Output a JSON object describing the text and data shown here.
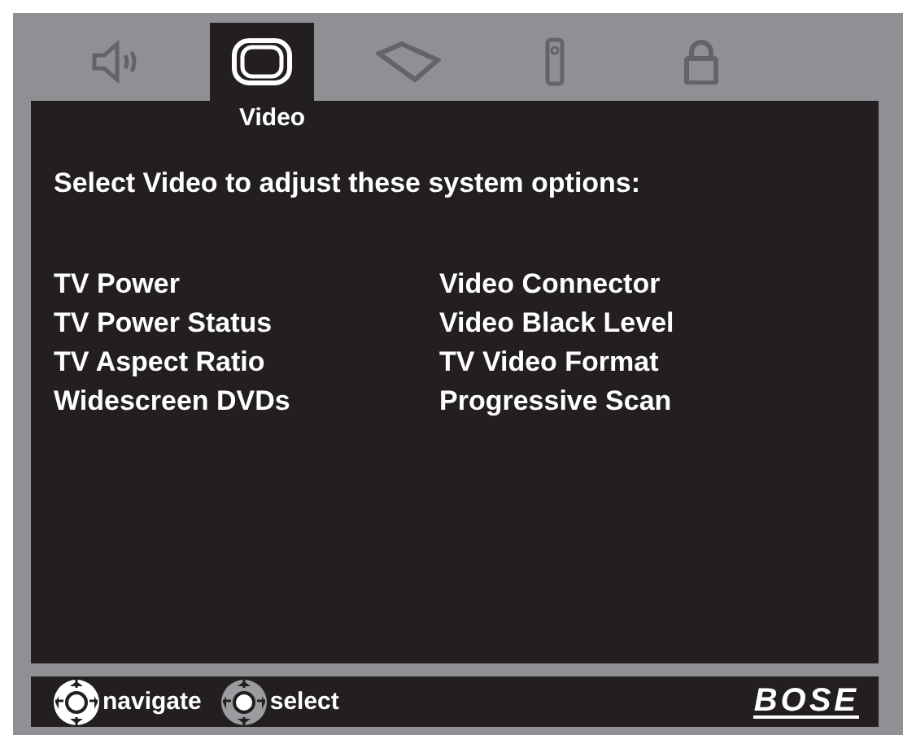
{
  "tabs": [
    {
      "kind": "speaker",
      "selected": false
    },
    {
      "kind": "video",
      "selected": true,
      "label": "Video"
    },
    {
      "kind": "player",
      "selected": false
    },
    {
      "kind": "remote",
      "selected": false
    },
    {
      "kind": "lock",
      "selected": false
    }
  ],
  "heading": "Select Video to adjust these system options:",
  "options": [
    [
      "TV Power",
      "TV Power Status",
      "TV Aspect Ratio",
      "Widescreen DVDs"
    ],
    [
      "Video Connector",
      "Video Black Level",
      "TV Video Format",
      "Progressive Scan"
    ]
  ],
  "footer": {
    "hints": [
      {
        "kind": "navigate",
        "label": "navigate"
      },
      {
        "kind": "select",
        "label": "select"
      }
    ],
    "logo": "BOSE"
  }
}
